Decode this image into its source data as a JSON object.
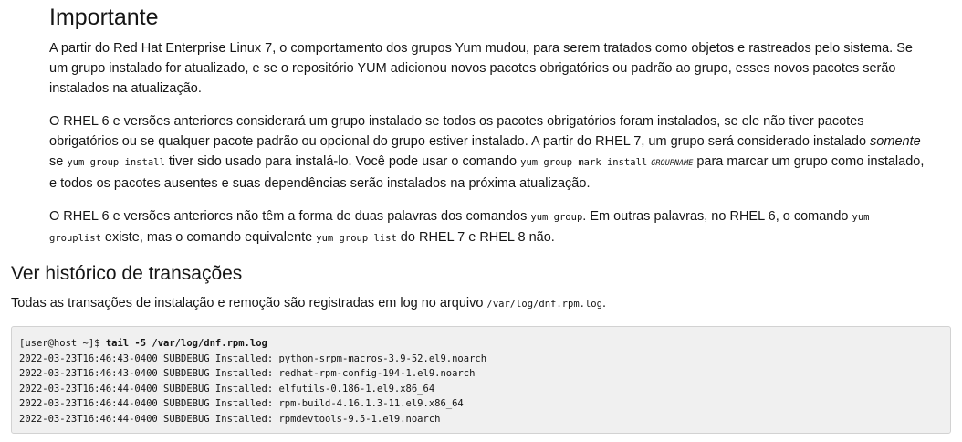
{
  "important": {
    "title": "Importante",
    "p1": "A partir do Red Hat Enterprise Linux 7, o comportamento dos grupos Yum mudou, para serem tratados como objetos e rastreados pelo sistema. Se um grupo instalado for atualizado, e se o repositório YUM adicionou novos pacotes obrigatórios ou padrão ao grupo, esses novos pacotes serão instalados na atualização.",
    "p2": {
      "t1": "O RHEL 6 e versões anteriores considerará um grupo instalado se todos os pacotes obrigatórios foram instalados, se ele não tiver pacotes obrigatórios ou se qualquer pacote padrão ou opcional do grupo estiver instalado. A partir do RHEL 7, um grupo será considerado instalado ",
      "em": "somente",
      "t2": " se ",
      "code1": "yum group install",
      "t3": " tiver sido usado para instalá-lo. Você pode usar o comando ",
      "code2": "yum group mark install",
      "var": "GROUPNAME",
      "t4": " para marcar um grupo como instalado, e todos os pacotes ausentes e suas dependências serão instalados na próxima atualização."
    },
    "p3": {
      "t1": "O RHEL 6 e versões anteriores não têm a forma de duas palavras dos comandos ",
      "code1": "yum group",
      "t2": ". Em outras palavras, no RHEL 6, o comando ",
      "code2": "yum grouplist",
      "t3": " existe, mas o comando equivalente ",
      "code3": "yum group list",
      "t4": " do RHEL 7 e RHEL 8 não."
    }
  },
  "section": {
    "title": "Ver histórico de transações",
    "lead_text": "Todas as transações de instalação e remoção são registradas em log no arquivo ",
    "lead_code": "/var/log/dnf.rpm.log",
    "lead_end": "."
  },
  "terminal": {
    "prompt": "[user@host ~]$ ",
    "command": "tail -5 /var/log/dnf.rpm.log",
    "lines": [
      "2022-03-23T16:46:43-0400 SUBDEBUG Installed: python-srpm-macros-3.9-52.el9.noarch",
      "2022-03-23T16:46:43-0400 SUBDEBUG Installed: redhat-rpm-config-194-1.el9.noarch",
      "2022-03-23T16:46:44-0400 SUBDEBUG Installed: elfutils-0.186-1.el9.x86_64",
      "2022-03-23T16:46:44-0400 SUBDEBUG Installed: rpm-build-4.16.1.3-11.el9.x86_64",
      "2022-03-23T16:46:44-0400 SUBDEBUG Installed: rpmdevtools-9.5-1.el9.noarch"
    ]
  }
}
